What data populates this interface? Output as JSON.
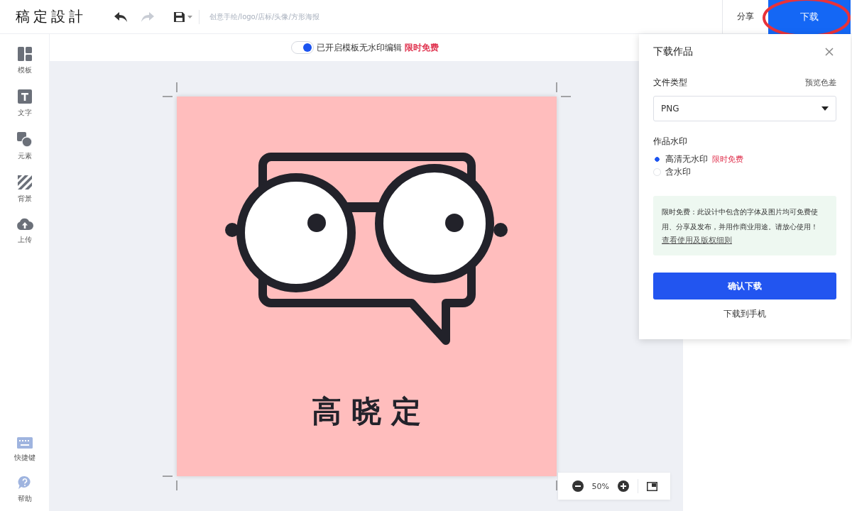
{
  "header": {
    "logo": "稿定設計",
    "design_title": "创意手绘/logo/店标/头像/方形海报",
    "share": "分享",
    "download": "下载"
  },
  "watermark_toggle": {
    "on": true,
    "label": "已开启模板无水印编辑",
    "badge": "限时免费"
  },
  "sidebar": {
    "items": [
      {
        "kind": "template",
        "label": "模板"
      },
      {
        "kind": "text",
        "label": "文字"
      },
      {
        "kind": "element",
        "label": "元素"
      },
      {
        "kind": "background",
        "label": "背景"
      },
      {
        "kind": "upload",
        "label": "上传"
      }
    ],
    "bottom_items": [
      {
        "kind": "keyboard",
        "label": "快捷键"
      },
      {
        "kind": "help",
        "label": "帮助"
      }
    ]
  },
  "artwork": {
    "text": "高晓定"
  },
  "zoom": {
    "reading": "50%"
  },
  "download_panel": {
    "title": "下载作品",
    "file_type_label": "文件类型",
    "preview_label": "预览色差",
    "file_type_value": "PNG",
    "watermark_label": "作品水印",
    "options": [
      {
        "label": "高清无水印",
        "badge": "限时免费",
        "selected": true
      },
      {
        "label": "含水印",
        "selected": false
      }
    ],
    "notice": {
      "text": "限时免费：此设计中包含的字体及图片均可免费使用、分享及发布，并用作商业用途。请放心使用！",
      "link": "查看使用及版权细则"
    },
    "confirm_button": "确认下载",
    "phone_link": "下载到手机"
  }
}
